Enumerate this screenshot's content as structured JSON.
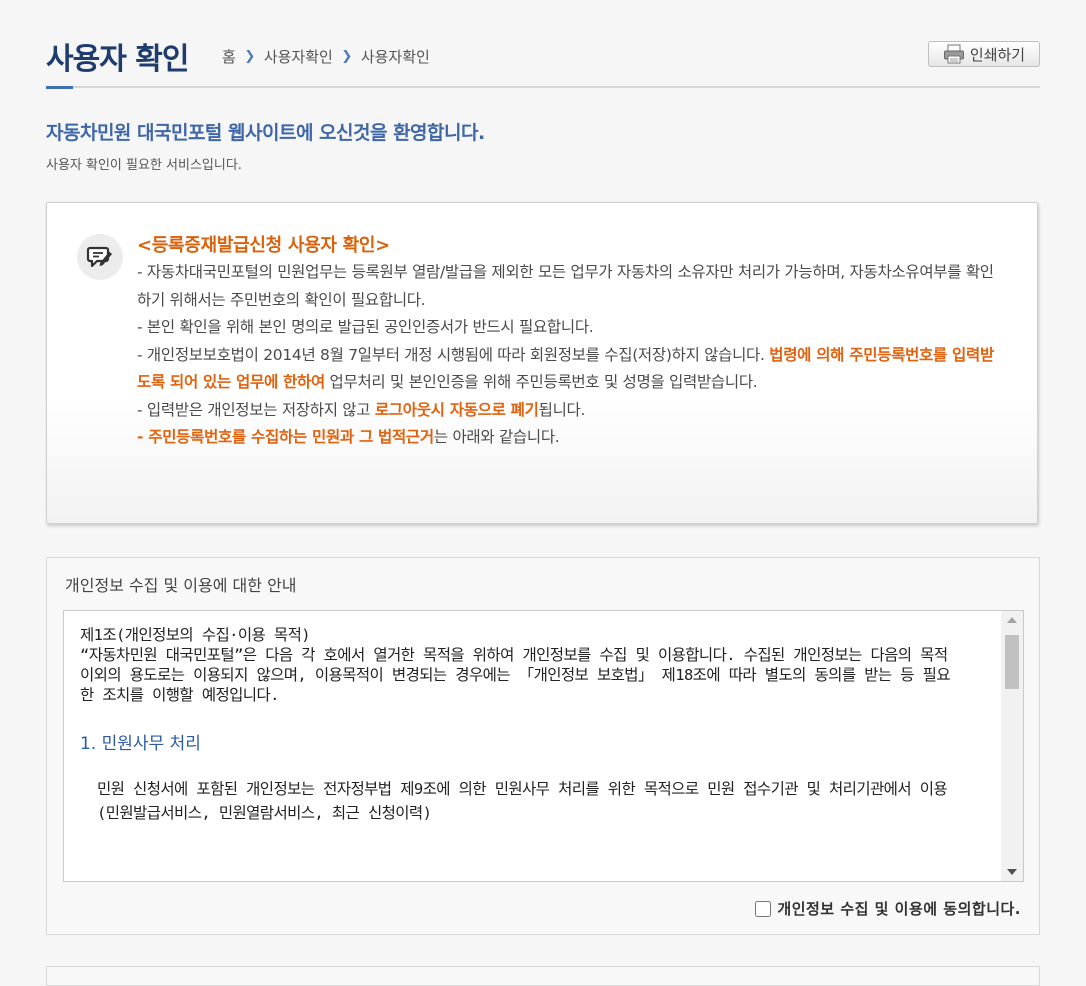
{
  "header": {
    "title": "사용자 확인",
    "breadcrumb": [
      "홈",
      "사용자확인",
      "사용자확인"
    ],
    "print_label": "인쇄하기"
  },
  "welcome": {
    "title": "자동차민원 대국민포털 웹사이트에 오신것을 환영합니다.",
    "subtitle": "사용자 확인이 필요한 서비스입니다."
  },
  "notice": {
    "icon": "memo-pencil-icon",
    "heading": "<등록증재발급신청 사용자 확인>",
    "line1": "- 자동차대국민포털의 민원업무는 등록원부 열람/발급을 제외한 모든 업무가 자동차의 소유자만 처리가 가능하며, 자동차소유여부를 확인하기 위해서는 주민번호의 확인이 필요합니다.",
    "line2": "- 본인 확인을 위해 본인 명의로 발급된 공인인증서가 반드시 필요합니다.",
    "line3_a": "- 개인정보보호법이 2014년 8월 7일부터 개정 시행됨에 따라 회원정보를 수집(저장)하지 않습니다. ",
    "line3_hl": "법령에 의해 주민등록번호를 입력받도록 되어 있는 업무에 한하여",
    "line3_b": " 업무처리 및 본인인증을 위해 주민등록번호 및 성명을 입력받습니다.",
    "line4_a": "- 입력받은 개인정보는 저장하지 않고 ",
    "line4_hl": "로그아웃시 자동으로 폐기",
    "line4_b": "됩니다.",
    "line5_hl": "- 주민등록번호를 수집하는 민원과 그 법적근거",
    "line5_b": "는 아래와 같습니다."
  },
  "privacy": {
    "title": "개인정보 수집 및 이용에 대한 안내",
    "article_title": "제1조(개인정보의 수집·이용 목적)",
    "article_body": "“자동차민원 대국민포털”은 다음 각 호에서 열거한 목적을 위하여 개인정보를 수집 및 이용합니다. 수집된 개인정보는 다음의 목적 이외의 용도로는 이용되지 않으며, 이용목적이 변경되는 경우에는 「개인정보 보호법」 제18조에 따라 별도의 동의를 받는 등 필요한 조치를 이행할 예정입니다.",
    "section1_title": "1. 민원사무 처리",
    "section1_body": "민원 신청서에 포함된 개인정보는 전자정부법 제9조에 의한 민원사무 처리를 위한 목적으로 민원 접수기관 및 처리기관에서 이용 (민원발급서비스, 민원열람서비스, 최근 신청이력)",
    "agree_label": "개인정보 수집 및 이용에 동의합니다."
  },
  "colors": {
    "title_navy": "#1e3c6e",
    "accent_blue": "#3f6fb3",
    "highlight_orange": "#e0620e"
  }
}
